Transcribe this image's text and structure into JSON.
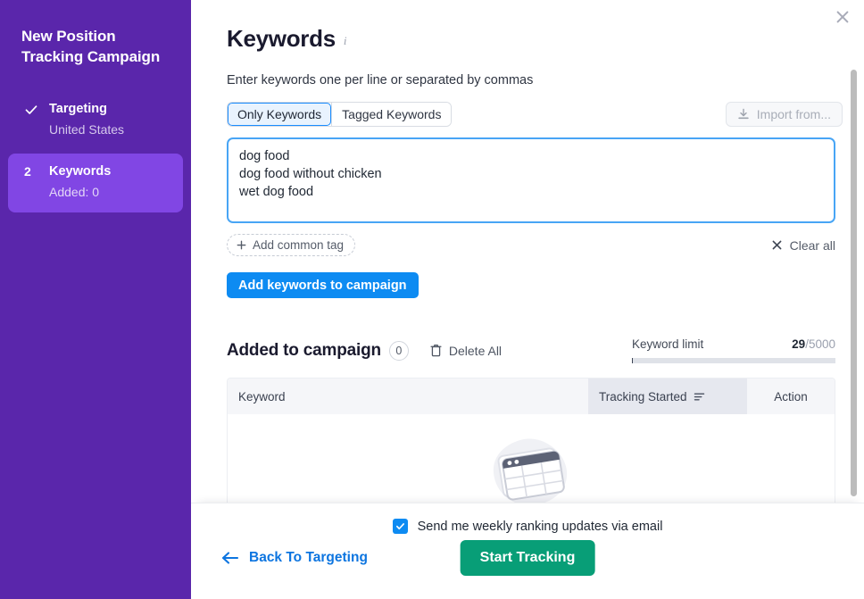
{
  "sidebar": {
    "title": "New Position Tracking Campaign",
    "steps": [
      {
        "marker": "check",
        "label": "Targeting",
        "sub": "United States",
        "active": false
      },
      {
        "marker": "2",
        "label": "Keywords",
        "sub": "Added: 0",
        "active": true
      }
    ]
  },
  "header": {
    "title": "Keywords",
    "info_icon": "i",
    "close_icon": "close-icon"
  },
  "main": {
    "helper_text": "Enter keywords one per line or separated by commas",
    "tabs": [
      {
        "label": "Only Keywords",
        "active": true
      },
      {
        "label": "Tagged Keywords",
        "active": false
      }
    ],
    "import_button": {
      "label": "Import from...",
      "icon": "download-icon",
      "disabled": true
    },
    "keyword_textarea": {
      "value": "dog food\ndog food without chicken\nwet dog food",
      "placeholder": "Enter keywords one per line or separated by commas"
    },
    "add_common_tag_label": "Add common tag",
    "add_common_tag_icon": "plus-icon",
    "clear_all_label": "Clear all",
    "clear_all_icon": "close-icon",
    "add_keywords_button": "Add keywords to campaign"
  },
  "added_section": {
    "title": "Added to campaign",
    "count": "0",
    "delete_all_label": "Delete All",
    "delete_all_icon": "trash-icon",
    "keyword_limit_label": "Keyword limit",
    "keyword_limit_used": "29",
    "keyword_limit_total": "/5000",
    "keyword_limit_percent": 0.58
  },
  "table": {
    "columns": [
      {
        "label": "Keyword",
        "sortable": false
      },
      {
        "label": "Tracking Started",
        "sortable": true,
        "sort_icon": "sort-icon"
      },
      {
        "label": "Action",
        "sortable": false
      }
    ],
    "rows": [],
    "empty_illustration": "empty-table-illustration"
  },
  "footer": {
    "weekly_updates_label": "Send me weekly ranking updates via email",
    "weekly_updates_checked": true,
    "back_label": "Back To Targeting",
    "back_icon": "arrow-left-icon",
    "start_label": "Start Tracking"
  },
  "colors": {
    "sidebar_purple": "#5a26ab",
    "sidebar_active": "#8146e4",
    "primary_blue": "#0d8bf2",
    "focus_blue": "#48a5f5",
    "start_green": "#089e77",
    "link_blue": "#0d75e0"
  }
}
